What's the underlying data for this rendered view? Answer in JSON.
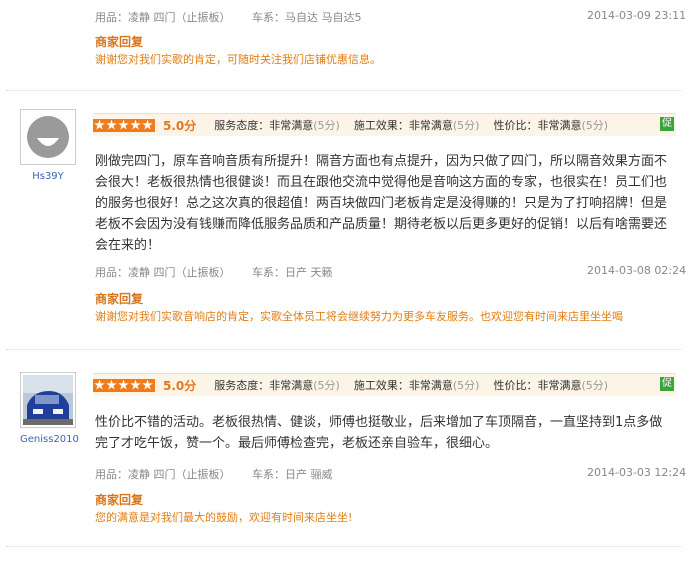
{
  "top_item": {
    "meta": {
      "product": "用品：凌静  四门（止振板）",
      "car": "车系：马自达  马自达5",
      "time": "2014-03-09  23:11"
    },
    "reply_title": "商家回复",
    "reply_text": "谢谢您对我们实歌的肯定，可随时关注我们店铺优惠信息。"
  },
  "reviews": [
    {
      "username": "Hs39Y",
      "stars": 5,
      "score": "5.0分",
      "criteria": [
        {
          "label": "服务态度：非常满意",
          "pts": "(5分)"
        },
        {
          "label": "施工效果：非常满意",
          "pts": "(5分)"
        },
        {
          "label": "性价比：非常满意",
          "pts": "(5分)"
        }
      ],
      "badge": "促",
      "content": "刚做完四门，原车音响音质有所提升！隔音方面也有点提升，因为只做了四门，所以隔音效果方面不会很大！老板很热情也很健谈！而且在跟他交流中觉得他是音响这方面的专家，也很实在！员工们也的服务也很好！总之这次真的很超值！两百块做四门老板肯定是没得赚的！只是为了打响招牌！但是老板不会因为没有钱赚而降低服务品质和产品质量！期待老板以后更多更好的促销！以后有啥需要还会在来的！",
      "meta": {
        "product": "用品：凌静  四门（止振板）",
        "car": "车系：日产  天籁",
        "time": "2014-03-08  02:24"
      },
      "reply_title": "商家回复",
      "reply_text": "谢谢您对我们实歌音响店的肯定，实歌全体员工将会继续努力为更多车友服务。也欢迎您有时间来店里坐坐喝"
    },
    {
      "username": "Geniss2010",
      "stars": 5,
      "score": "5.0分",
      "criteria": [
        {
          "label": "服务态度：非常满意",
          "pts": "(5分)"
        },
        {
          "label": "施工效果：非常满意",
          "pts": "(5分)"
        },
        {
          "label": "性价比：非常满意",
          "pts": "(5分)"
        }
      ],
      "badge": "促",
      "content": "性价比不错的活动。老板很热情、健谈，师傅也挺敬业，后来增加了车顶隔音，一直坚持到1点多做完了才吃午饭，赞一个。最后师傅检查完，老板还亲自验车，很细心。",
      "meta": {
        "product": "用品：凌静  四门（止振板）",
        "car": "车系：日产  骊威",
        "time": "2014-03-03  12:24"
      },
      "reply_title": "商家回复",
      "reply_text": "您的满意是对我们最大的鼓励，欢迎有时间来店坐坐!"
    }
  ],
  "colors": {
    "accent": "#e8751b",
    "reply": "#e07d14",
    "username": "#3a64b5",
    "badge": "#3aa637",
    "rating_bg": "#fcf5e7"
  },
  "icons": {
    "star": "star-icon",
    "default_avatar": "default-avatar-icon",
    "car_avatar": "car-photo-avatar",
    "badge": "promo-badge-icon"
  }
}
